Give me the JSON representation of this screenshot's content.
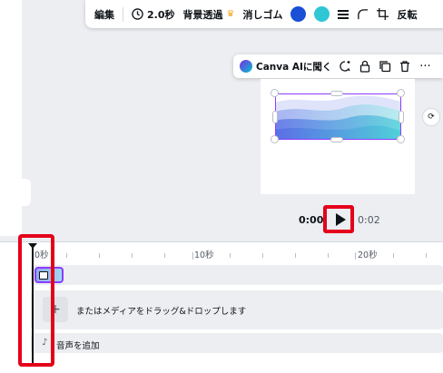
{
  "toolbar": {
    "edit_label": "編集",
    "duration_label": "2.0秒",
    "bg_remove_label": "背景透過",
    "eraser_label": "消しゴム",
    "flip_label": "反転",
    "color1": "#1a4fd6",
    "color2": "#2ec7d3"
  },
  "ai_bar": {
    "label": "Canva AIに聞く",
    "more_label": "···"
  },
  "playback": {
    "current_time": "0:00",
    "end_time": "0:02"
  },
  "timeline": {
    "ticks": [
      "0秒",
      "10秒",
      "20秒"
    ],
    "media_drop_text": "またはメディアをドラッグ&ドロップします",
    "add_media_symbol": "+",
    "add_audio_text": "音声を追加",
    "audio_icon": "♪"
  },
  "colors": {
    "accent": "#8b3dff",
    "highlight": "#e5001a"
  }
}
